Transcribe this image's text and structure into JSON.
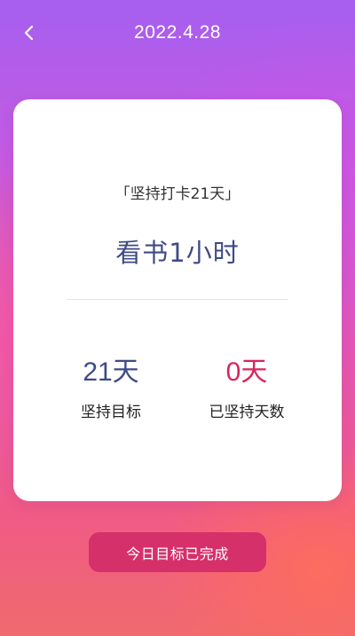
{
  "header": {
    "back_icon": "chevron-left-icon",
    "title": "2022.4.28"
  },
  "card": {
    "challenge": "「坚持打卡21天」",
    "task": "看书1小时",
    "target": {
      "value": "21天",
      "label": "坚持目标"
    },
    "streak": {
      "value": "0天",
      "label": "已坚持天数"
    }
  },
  "action": {
    "label": "今日目标已完成"
  },
  "colors": {
    "primary_text": "#3f4a86",
    "accent": "#d8245e",
    "button": "#d6306a"
  }
}
